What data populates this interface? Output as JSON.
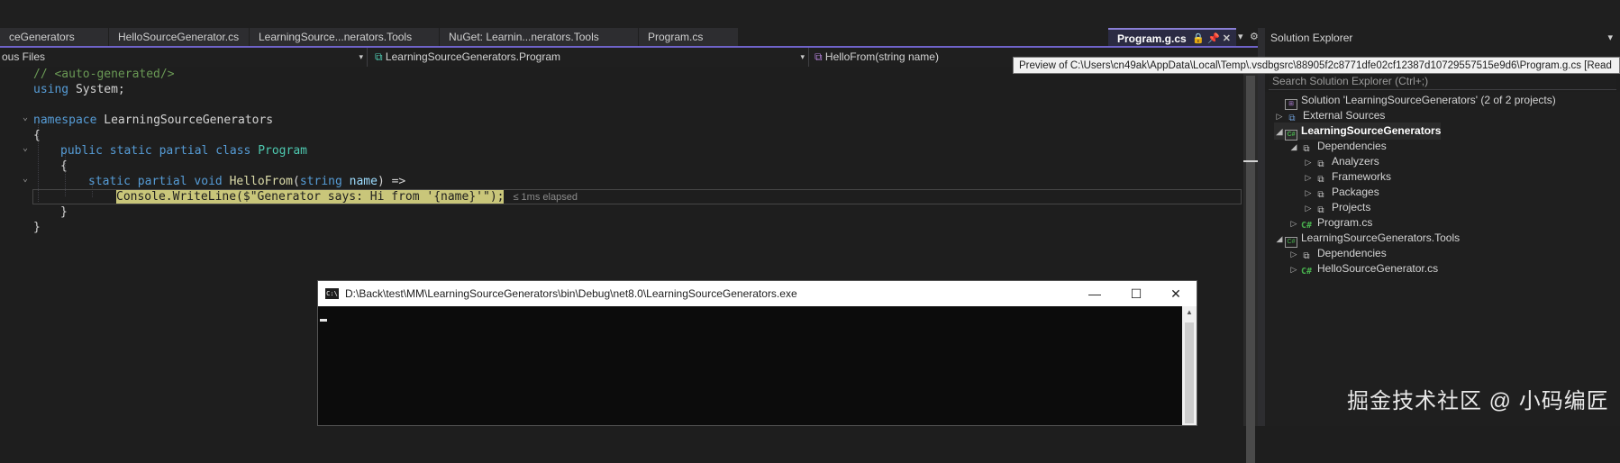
{
  "tabs": [
    {
      "label": "ceGenerators",
      "active": false
    },
    {
      "label": "HelloSourceGenerator.cs",
      "active": false
    },
    {
      "label": "LearningSource...nerators.Tools",
      "active": false
    },
    {
      "label": "NuGet: Learnin...nerators.Tools",
      "active": false
    },
    {
      "label": "Program.cs",
      "active": false
    },
    {
      "label": "Program.g.cs",
      "active": true
    }
  ],
  "nav": {
    "project": "ous Files",
    "type": "LearningSourceGenerators.Program",
    "member": "HelloFrom(string name)"
  },
  "tooltip": "Preview of C:\\Users\\cn49ak\\AppData\\Local\\Temp\\.vsdbgsrc\\88905f2c8771dfe02cf12387d10729557515e9d6\\Program.g.cs [Read",
  "code": {
    "l1": "// <auto-generated/>",
    "l2_kw": "using",
    "l2_rest": " System;",
    "l3_kw": "namespace",
    "l3_rest": " LearningSourceGenerators",
    "l4": "{",
    "l5_kw1": "public",
    "l5_kw2": "static",
    "l5_kw3": "partial",
    "l5_kw4": "class",
    "l5_cls": "Program",
    "l6": "{",
    "l7_kw1": "static",
    "l7_kw2": "partial",
    "l7_kw3": "void",
    "l7_fn": "HelloFrom",
    "l7_open": "(",
    "l7_kw4": "string",
    "l7_pm": "name",
    "l7_close": ") =>",
    "l8_stmt": "Console.WriteLine($\"Generator says: Hi from '{name}'\");",
    "l8_elapsed": "≤ 1ms elapsed",
    "l9": "}",
    "l10": "}"
  },
  "solution_explorer": {
    "title": "Solution Explorer",
    "search_placeholder": "Search Solution Explorer (Ctrl+;)",
    "items": [
      {
        "label": "Solution 'LearningSourceGenerators' (2 of 2 projects)",
        "icon": "solution-icon"
      },
      {
        "label": "External Sources",
        "icon": "external-sources-icon"
      },
      {
        "label": "LearningSourceGenerators",
        "icon": "csharp-project-icon"
      },
      {
        "label": "Dependencies",
        "icon": "dependencies-icon"
      },
      {
        "label": "Analyzers",
        "icon": "analyzers-icon"
      },
      {
        "label": "Frameworks",
        "icon": "frameworks-icon"
      },
      {
        "label": "Packages",
        "icon": "packages-icon"
      },
      {
        "label": "Projects",
        "icon": "projects-icon"
      },
      {
        "label": "Program.cs",
        "icon": "csharp-file-icon"
      },
      {
        "label": "LearningSourceGenerators.Tools",
        "icon": "csharp-project-icon"
      },
      {
        "label": "Dependencies",
        "icon": "dependencies-icon"
      },
      {
        "label": "HelloSourceGenerator.cs",
        "icon": "csharp-file-icon"
      }
    ]
  },
  "console": {
    "title": "D:\\Back\\test\\MM\\LearningSourceGenerators\\bin\\Debug\\net8.0\\LearningSourceGenerators.exe",
    "icon_text": "C:\\"
  },
  "glyphs": {
    "lock": "🔒",
    "pin": "📌",
    "close": "✕",
    "dropdown": "▾",
    "gear": "⚙",
    "fold_open": "⌄",
    "minimize": "—",
    "maximize": "☐",
    "expanded": "◢",
    "collapsed": "▷",
    "cs": "C#",
    "method_box": "⧉",
    "solution": "⊞",
    "proj_box": "C#"
  },
  "watermark": "掘金技术社区 @ 小码编匠",
  "colors": {
    "accent": "#6f63c9",
    "keyword": "#569cd6",
    "type": "#4ec9b0",
    "function": "#dcdcaa",
    "comment": "#6a9955",
    "highlight": "#c9c67a"
  }
}
